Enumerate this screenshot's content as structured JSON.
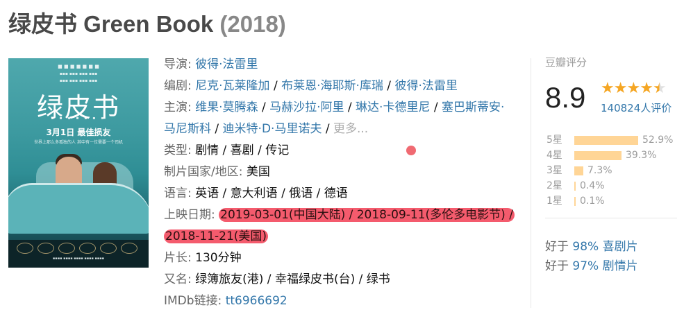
{
  "title": {
    "cn": "绿皮书",
    "en": "Green Book",
    "year": "(2018)"
  },
  "poster": {
    "title": "绿皮书",
    "date": "3月1日 最佳损友",
    "tagline": "世界上那么多孤独的人 其中有一位需要一个司机"
  },
  "info": {
    "director": {
      "label": "导演:",
      "values": [
        "彼得·法雷里"
      ]
    },
    "writer": {
      "label": "编剧:",
      "values": [
        "尼克·瓦莱隆加",
        "布莱恩·海耶斯·库瑞",
        "彼得·法雷里"
      ]
    },
    "cast": {
      "label": "主演:",
      "values": [
        "维果·莫腾森",
        "马赫沙拉·阿里",
        "琳达·卡德里尼",
        "塞巴斯蒂安·马尼斯科",
        "迪米特·D·马里诺夫"
      ],
      "more": "更多..."
    },
    "genre": {
      "label": "类型:",
      "value": "剧情 / 喜剧 / 传记"
    },
    "country": {
      "label": "制片国家/地区:",
      "value": "美国"
    },
    "language": {
      "label": "语言:",
      "value": "英语 / 意大利语 / 俄语 / 德语"
    },
    "release": {
      "label": "上映日期:",
      "value": "2019-03-01(中国大陆) / 2018-09-11(多伦多电影节) / 2018-11-21(美国)"
    },
    "runtime": {
      "label": "片长:",
      "value": "130分钟"
    },
    "aka": {
      "label": "又名:",
      "value": "绿簿旅友(港) / 幸福绿皮书(台) / 绿书"
    },
    "imdb": {
      "label": "IMDb链接:",
      "value": "tt6966692"
    }
  },
  "rating": {
    "title": "豆瓣评分",
    "score": "8.9",
    "stars_value": 4.5,
    "votes": "140824人评价",
    "distribution": [
      {
        "label": "5星",
        "pct": "52.9%",
        "value": 52.9
      },
      {
        "label": "4星",
        "pct": "39.3%",
        "value": 39.3
      },
      {
        "label": "3星",
        "pct": "7.3%",
        "value": 7.3
      },
      {
        "label": "2星",
        "pct": "0.4%",
        "value": 0.4
      },
      {
        "label": "1星",
        "pct": "0.1%",
        "value": 0.1
      }
    ],
    "better_than": [
      {
        "prefix": "好于",
        "pct": "98%",
        "genre": "喜剧片"
      },
      {
        "prefix": "好于",
        "pct": "97%",
        "genre": "剧情片"
      }
    ]
  },
  "colors": {
    "link": "#3377aa",
    "highlight": "#f45b6d",
    "bar": "#ffd596",
    "star": "#f5a623"
  }
}
